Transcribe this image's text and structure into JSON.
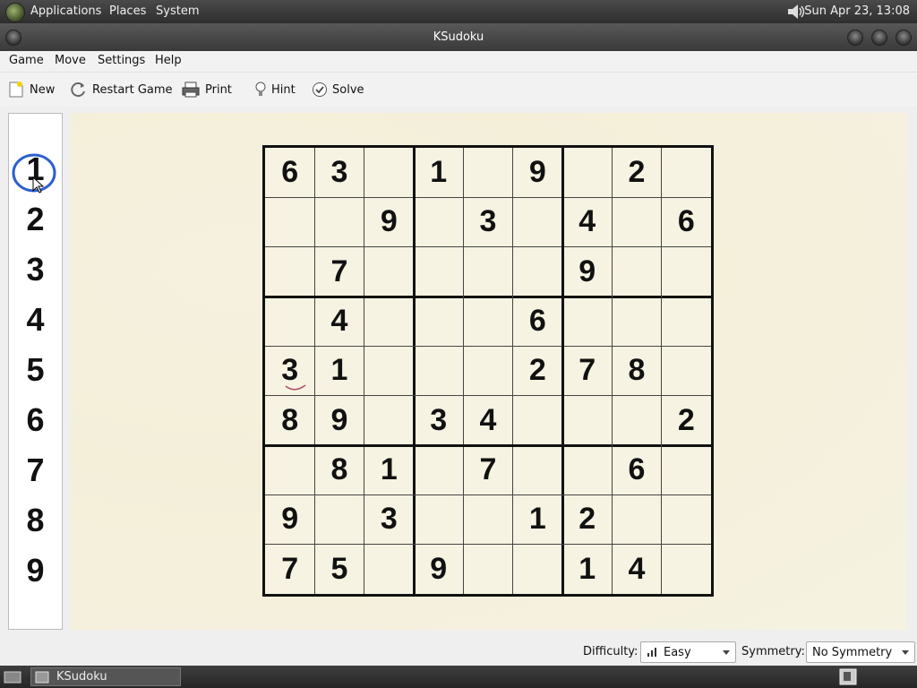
{
  "top_panel": {
    "menus": [
      "Applications",
      "Places",
      "System"
    ],
    "clock": "Sun Apr 23, 13:08"
  },
  "window": {
    "title": "KSudoku"
  },
  "menubar": [
    "Game",
    "Move",
    "Settings",
    "Help"
  ],
  "toolbar": {
    "new_label": "New",
    "restart_label": "Restart Game",
    "print_label": "Print",
    "hint_label": "Hint",
    "solve_label": "Solve"
  },
  "number_selector": {
    "numbers": [
      "1",
      "2",
      "3",
      "4",
      "5",
      "6",
      "7",
      "8",
      "9"
    ],
    "selected": "1",
    "selected_ring_color": "#2d5fcf"
  },
  "board": {
    "rows": [
      [
        "6",
        "3",
        "",
        "1",
        "",
        "9",
        "",
        "2",
        ""
      ],
      [
        "",
        "",
        "9",
        "",
        "3",
        "",
        "4",
        "",
        "6"
      ],
      [
        "",
        "7",
        "",
        "",
        "",
        "",
        "9",
        "",
        ""
      ],
      [
        "",
        "4",
        "",
        "",
        "",
        "6",
        "",
        "",
        ""
      ],
      [
        "3",
        "1",
        "",
        "",
        "",
        "2",
        "7",
        "8",
        ""
      ],
      [
        "8",
        "9",
        "",
        "3",
        "4",
        "",
        "",
        "",
        "2"
      ],
      [
        "",
        "8",
        "1",
        "",
        "7",
        "",
        "",
        "6",
        ""
      ],
      [
        "9",
        "",
        "3",
        "",
        "",
        "1",
        "2",
        "",
        ""
      ],
      [
        "7",
        "5",
        "",
        "9",
        "",
        "",
        "1",
        "4",
        ""
      ]
    ]
  },
  "status": {
    "difficulty_label": "Difficulty:",
    "difficulty_value": "Easy",
    "symmetry_label": "Symmetry:",
    "symmetry_value": "No Symmetry"
  },
  "taskbar": {
    "window_label": "KSudoku"
  }
}
